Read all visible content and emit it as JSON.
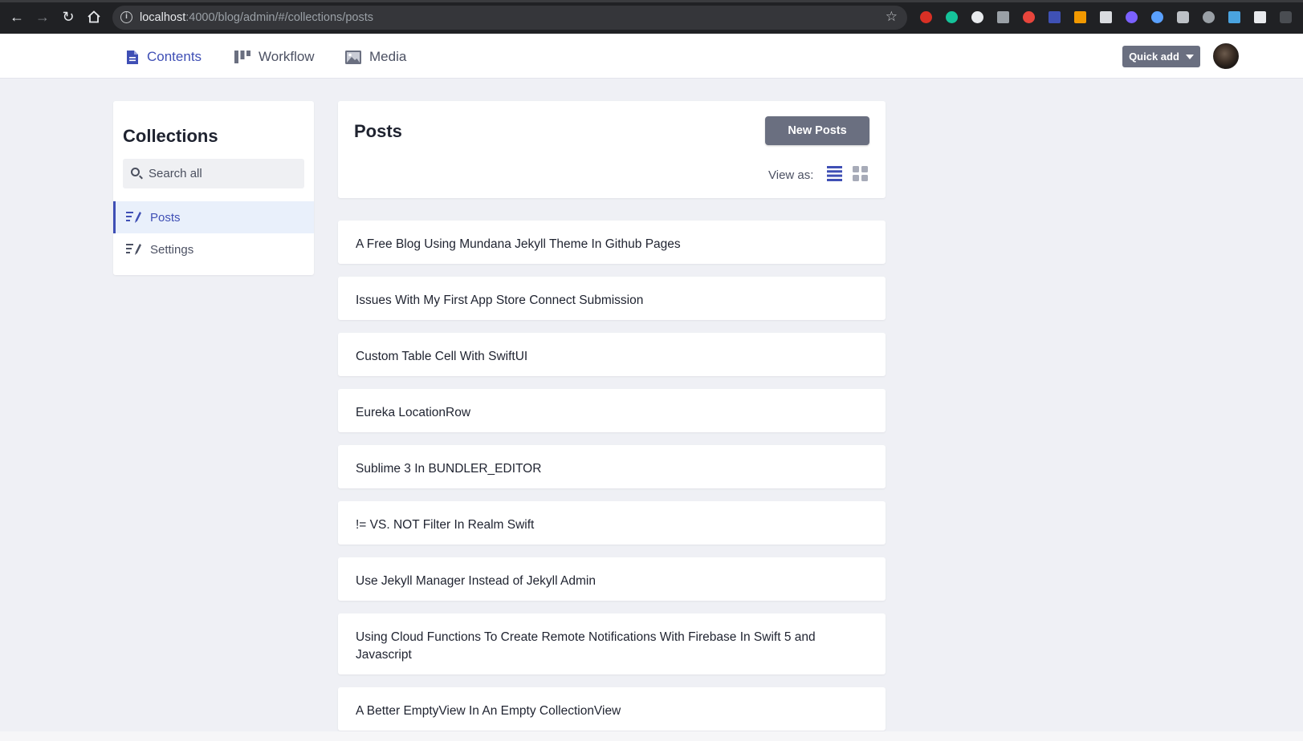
{
  "browser": {
    "url_host": "localhost",
    "url_rest": ":4000/blog/admin/#/collections/posts"
  },
  "nav": {
    "tabs": [
      {
        "label": "Contents",
        "icon": "document-icon"
      },
      {
        "label": "Workflow",
        "icon": "workflow-icon"
      },
      {
        "label": "Media",
        "icon": "image-icon"
      }
    ],
    "active_tab": "Contents",
    "quick_add_label": "Quick add"
  },
  "sidebar": {
    "title": "Collections",
    "search_placeholder": "Search all",
    "items": [
      {
        "label": "Posts",
        "icon": "edit-list-icon"
      },
      {
        "label": "Settings",
        "icon": "edit-list-icon"
      }
    ],
    "active_item": "Posts"
  },
  "main": {
    "title": "Posts",
    "new_button_label": "New Posts",
    "view_as_label": "View as:",
    "view_modes": [
      "list",
      "grid"
    ],
    "active_view": "list"
  },
  "posts": [
    {
      "title": "A Free Blog Using Mundana Jekyll Theme In Github Pages"
    },
    {
      "title": "Issues With My First App Store Connect Submission"
    },
    {
      "title": "Custom Table Cell With SwiftUI"
    },
    {
      "title": "Eureka LocationRow"
    },
    {
      "title": "Sublime 3 In BUNDLER_EDITOR"
    },
    {
      "title": "!= VS. NOT Filter In Realm Swift"
    },
    {
      "title": "Use Jekyll Manager Instead of Jekyll Admin"
    },
    {
      "title": "Using Cloud Functions To Create Remote Notifications With Firebase In Swift 5 and Javascript"
    },
    {
      "title": "A Better EmptyView In An Empty CollectionView"
    }
  ],
  "colors": {
    "accent": "#3f4fb5",
    "button": "#6a6f80",
    "background": "#eff0f5"
  }
}
